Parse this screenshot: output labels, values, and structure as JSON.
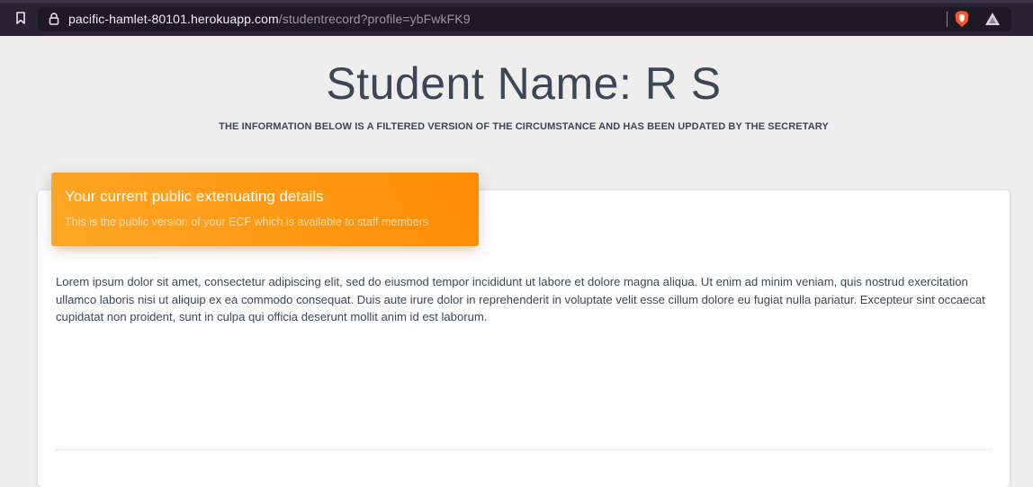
{
  "browser": {
    "url_host": "pacific-hamlet-80101.herokuapp.com",
    "url_path": "/studentrecord?profile=ybFwkFK9",
    "icons": [
      "bookmark-icon",
      "lock-icon",
      "brave-shield-icon",
      "brave-rewards-icon"
    ]
  },
  "header": {
    "title": "Student Name: R S",
    "subtitle": "THE INFORMATION BELOW IS A FILTERED VERSION OF THE CIRCUMSTANCE AND HAS BEEN UPDATED BY THE SECRETARY"
  },
  "card": {
    "title": "Your current public extenuating details",
    "category": "This is the public version of your ECF which is available to staff members",
    "body": "Lorem ipsum dolor sit amet, consectetur adipiscing elit, sed do eiusmod tempor incididunt ut labore et dolore magna aliqua. Ut enim ad minim veniam, quis nostrud exercitation ullamco laboris nisi ut aliquip ex ea commodo consequat. Duis aute irure dolor in reprehenderit in voluptate velit esse cillum dolore eu fugiat nulla pariatur. Excepteur sint occaecat cupidatat non proident, sunt in culpa qui officia deserunt mollit anim id est laborum."
  },
  "colors": {
    "page_background": "#eeeeee",
    "header_orange_start": "#ffa726",
    "header_orange_end": "#fb8c00",
    "text_dark": "#3d4656",
    "browser_bar": "#2a2233"
  }
}
